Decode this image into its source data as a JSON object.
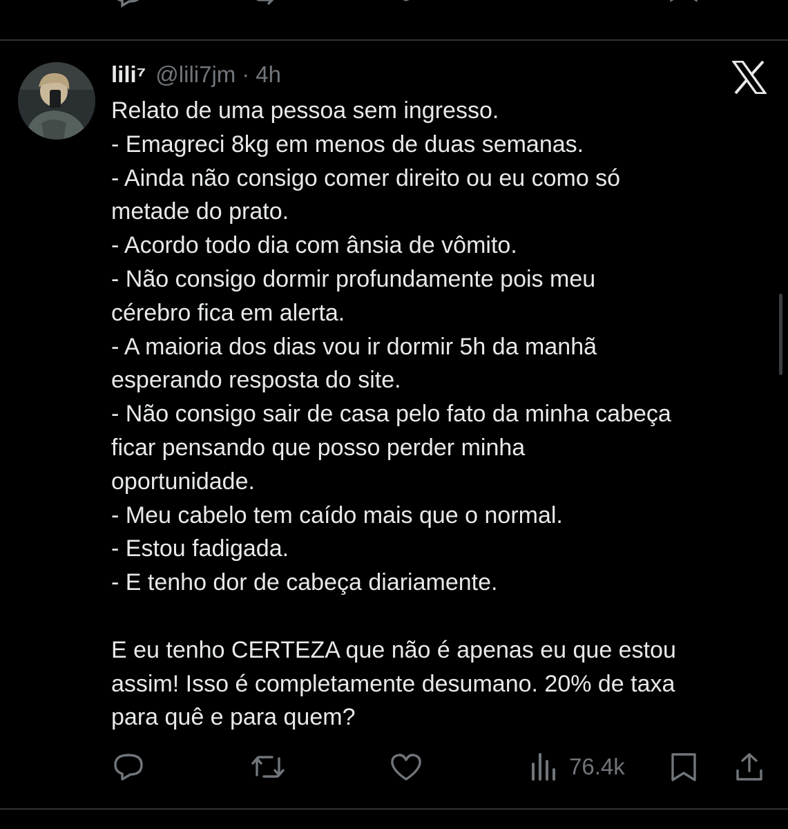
{
  "colors": {
    "background": "#000000",
    "text": "#e7e9ea",
    "muted": "#71767b",
    "divider": "#2f3336"
  },
  "tweet": {
    "author": {
      "name": "lili⁷",
      "handle": "@lili7jm",
      "separator": "·",
      "time": "4h",
      "avatar_icon": "avatar-photo"
    },
    "brand_icon": "x-logo-icon",
    "lines": [
      "Relato de uma pessoa sem ingresso.",
      "- Emagreci 8kg em menos de duas semanas.",
      "- Ainda não consigo comer direito ou eu como só",
      "metade do prato.",
      "- Acordo todo dia com ânsia de vômito.",
      "- Não consigo dormir profundamente pois meu",
      "cérebro fica em alerta.",
      "- A maioria dos dias vou ir dormir 5h da manhã",
      "esperando resposta do site.",
      "- Não consigo sair de casa pelo fato da minha cabeça",
      "ficar pensando que posso perder minha",
      "oportunidade.",
      "- Meu cabelo tem caído mais que o normal.",
      "- Estou fadigada.",
      "- E tenho dor de cabeça diariamente.",
      "",
      "E eu tenho CERTEZA que não é apenas eu que estou",
      "assim! Isso é completamente desumano. 20% de taxa",
      "para quê e para quem?"
    ],
    "actions": {
      "reply_icon": "reply-icon",
      "retweet_icon": "retweet-icon",
      "like_icon": "like-icon",
      "views_icon": "views-icon",
      "views_count": "76.4k",
      "bookmark_icon": "bookmark-icon",
      "share_icon": "share-icon"
    }
  }
}
